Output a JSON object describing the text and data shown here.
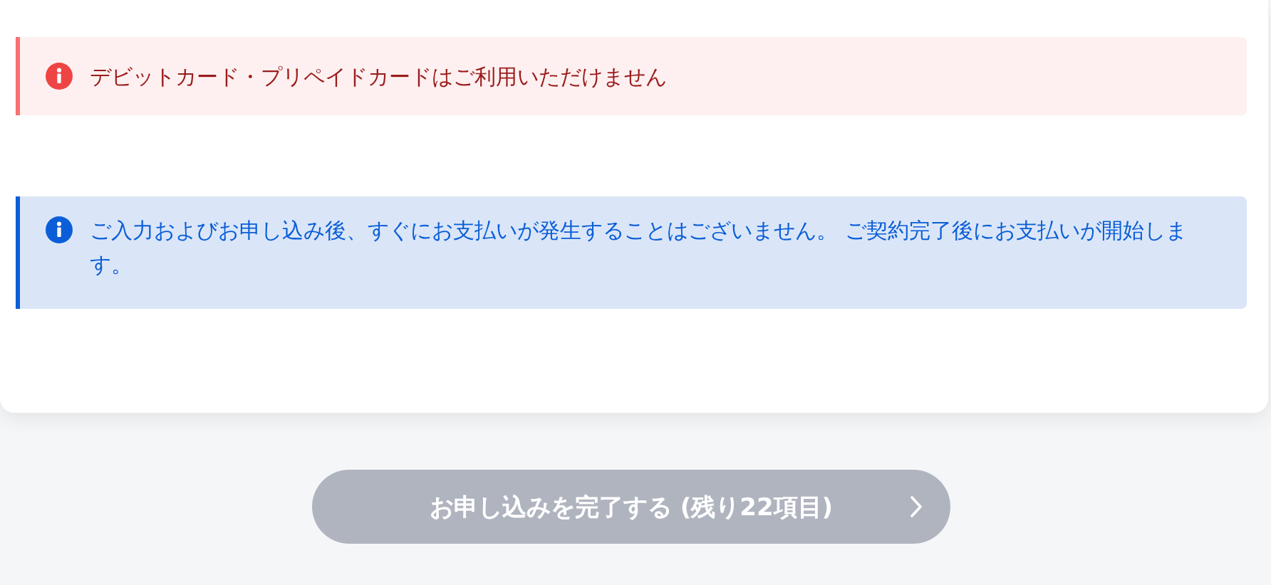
{
  "alerts": [
    {
      "kind": "error",
      "text": "デビットカード・プリペイドカードはご利用いただけません"
    },
    {
      "kind": "info",
      "text": "ご入力およびお申し込み後、すぐにお支払いが発生することはございません。 ご契約完了後にお支払いが開始します。"
    }
  ],
  "submit_button": {
    "label": "お申し込みを完了する (残り22項目)",
    "disabled": true
  }
}
